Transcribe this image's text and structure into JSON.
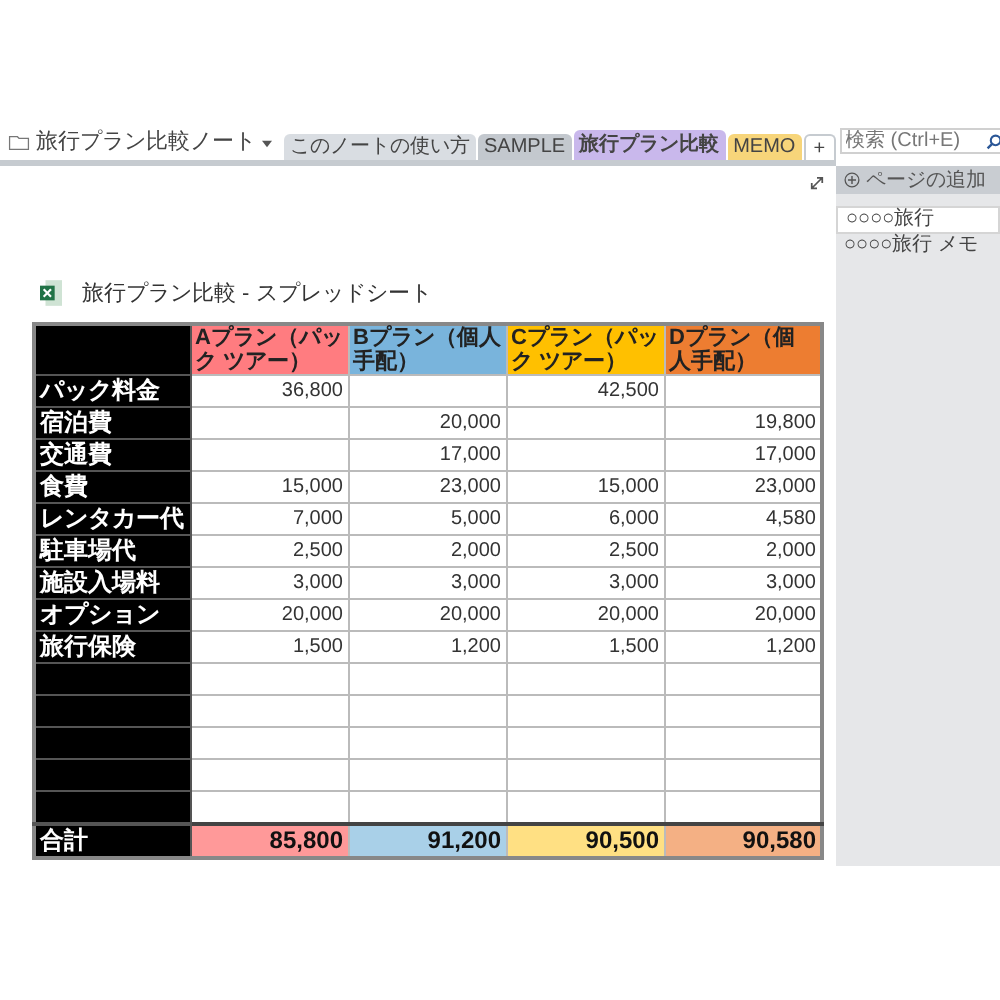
{
  "notebook": {
    "title": "旅行プラン比較ノート"
  },
  "section_tabs": [
    {
      "label": "このノートの使い方",
      "color": "#d9dde2",
      "selected": false
    },
    {
      "label": "SAMPLE",
      "color": "#c3c8ce",
      "selected": false
    },
    {
      "label": "旅行プラン比較",
      "color": "#c9b8ec",
      "selected": true
    },
    {
      "label": "MEMO",
      "color": "#f7d57a",
      "selected": false
    }
  ],
  "add_tab": "+",
  "search": {
    "placeholder": "検索 (Ctrl+E)"
  },
  "sidebar": {
    "add_page": "ページの追加",
    "pages": [
      {
        "title": "○○○○旅行",
        "selected": true
      },
      {
        "title": "○○○○旅行 メモ",
        "selected": false
      }
    ]
  },
  "embed": {
    "title": "旅行プラン比較 - スプレッドシート"
  },
  "table": {
    "columns": [
      {
        "label": "Aプラン（パック ツアー）",
        "color": "#ff7c80"
      },
      {
        "label": "Bプラン（個人手配）",
        "color": "#79b4dc"
      },
      {
        "label": "Cプラン（パック ツアー）",
        "color": "#ffc000"
      },
      {
        "label": "Dプラン（個人手配）",
        "color": "#ed7d31"
      }
    ],
    "rows": [
      {
        "label": "パック料金",
        "cells": [
          "36,800",
          null,
          "42,500",
          null
        ]
      },
      {
        "label": "宿泊費",
        "cells": [
          null,
          "20,000",
          null,
          "19,800"
        ]
      },
      {
        "label": "交通費",
        "cells": [
          null,
          "17,000",
          null,
          "17,000"
        ]
      },
      {
        "label": "食費",
        "cells": [
          "15,000",
          "23,000",
          "15,000",
          "23,000"
        ]
      },
      {
        "label": "レンタカー代",
        "cells": [
          "7,000",
          "5,000",
          "6,000",
          "4,580"
        ]
      },
      {
        "label": "駐車場代",
        "cells": [
          "2,500",
          "2,000",
          "2,500",
          "2,000"
        ]
      },
      {
        "label": "施設入場料",
        "cells": [
          "3,000",
          "3,000",
          "3,000",
          "3,000"
        ]
      },
      {
        "label": "オプション",
        "cells": [
          "20,000",
          "20,000",
          "20,000",
          "20,000"
        ]
      },
      {
        "label": "旅行保険",
        "cells": [
          "1,500",
          "1,200",
          "1,500",
          "1,200"
        ]
      }
    ],
    "total": {
      "label": "合計",
      "cells": [
        {
          "value": "85,800",
          "color": "#ff9999"
        },
        {
          "value": "91,200",
          "color": "#a9d0e8"
        },
        {
          "value": "90,500",
          "color": "#ffe083"
        },
        {
          "value": "90,580",
          "color": "#f4b084"
        }
      ]
    }
  }
}
